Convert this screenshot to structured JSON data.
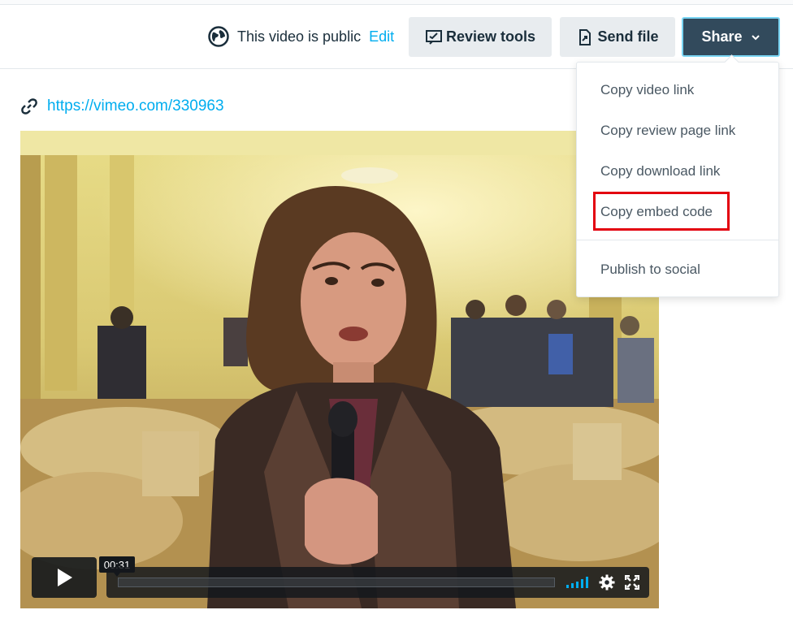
{
  "header": {
    "privacy_text": "This video is public",
    "edit_label": "Edit",
    "review_tools_label": "Review tools",
    "send_file_label": "Send file",
    "share_label": "Share"
  },
  "video_link": {
    "url": "https://vimeo.com/330963"
  },
  "player": {
    "time_tooltip": "00:31",
    "progress_fraction": 0.0
  },
  "share_menu": {
    "items": [
      {
        "label": "Copy video link"
      },
      {
        "label": "Copy review page link"
      },
      {
        "label": "Copy download link"
      },
      {
        "label": "Copy embed code",
        "highlighted": true
      },
      {
        "label": "Publish to social"
      }
    ]
  },
  "colors": {
    "accent_link": "#00adef",
    "share_button": "#324a5c",
    "highlight_box": "#e3000f"
  },
  "icons": [
    "globe-icon",
    "review-tools-icon",
    "send-file-icon",
    "chevron-down-icon",
    "link-icon",
    "play-icon",
    "volume-icon",
    "settings-icon",
    "fullscreen-icon"
  ]
}
